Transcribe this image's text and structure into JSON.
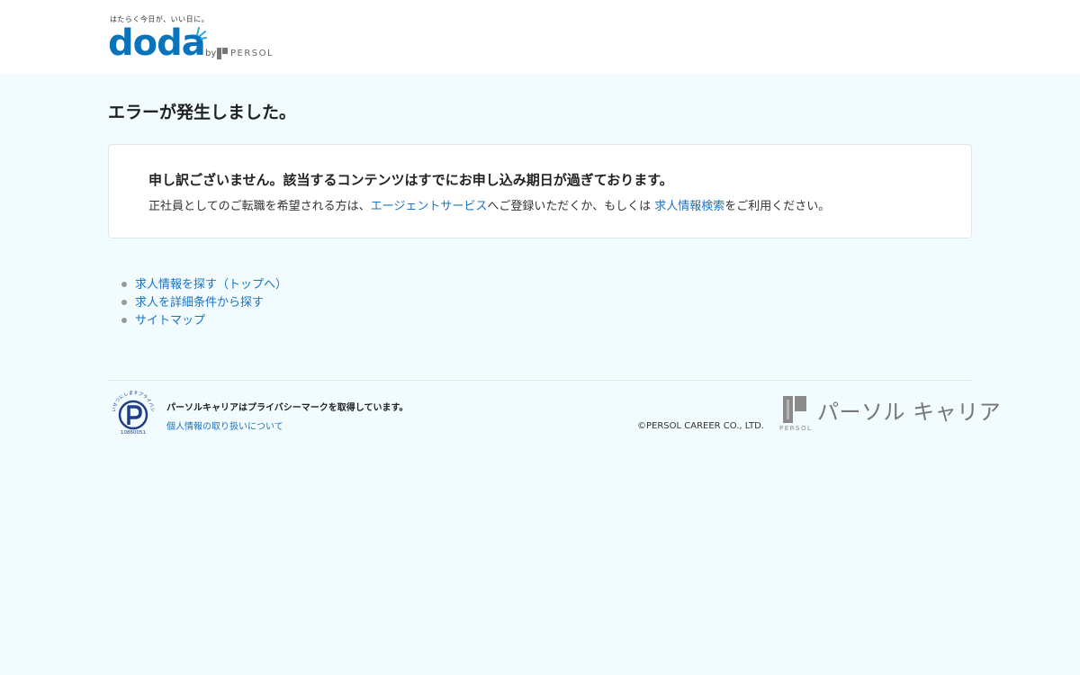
{
  "header": {
    "tagline": "はたらく今日が、いい日に。",
    "logo_word": "doda",
    "logo_by": "by",
    "logo_persol": "PERSOL"
  },
  "main": {
    "page_title": "エラーが発生しました。",
    "error_heading": "申し訳ございません。該当するコンテンツはすでにお申し込み期日が過ぎております。",
    "error_body": {
      "part1": "正社員としてのご転職を希望される方は、",
      "link1": "エージェントサービス",
      "part2": "へご登録いただくか、もしくは ",
      "link2": "求人情報検索",
      "part3": "をご利用ください。"
    },
    "links": [
      {
        "label": "求人情報を探す（トップへ）"
      },
      {
        "label": "求人を詳細条件から探す"
      },
      {
        "label": "サイトマップ"
      }
    ]
  },
  "footer": {
    "privacy_text": "パーソルキャリアはプライバシーマークを取得しています。",
    "privacy_link": "個人情報の取り扱いについて",
    "pmark_arc": "たいせつにしますプライバシー",
    "pmark_number": "10860051",
    "copyright": "©PERSOL CAREER CO., LTD.",
    "company_logo_name": "パーソル キャリア",
    "company_logo_small": "PERSOL"
  },
  "colors": {
    "brand": "#0b73b9",
    "link": "#1a73c6",
    "background": "#f2fbfd"
  }
}
